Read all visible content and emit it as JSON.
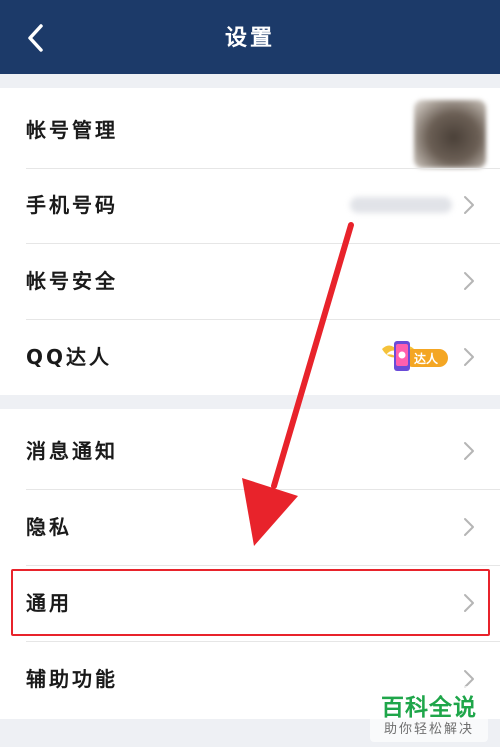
{
  "header": {
    "title": "设置",
    "back_icon": "chevron-left-icon"
  },
  "groups": [
    {
      "items": [
        {
          "label": "帐号管理",
          "accessory": "avatar"
        },
        {
          "label": "手机号码",
          "accessory": "blurred-phone-number"
        },
        {
          "label": "帐号安全",
          "accessory": "chevron"
        },
        {
          "label": "QQ达人",
          "accessory": "qq-daren-badge"
        }
      ]
    },
    {
      "items": [
        {
          "label": "消息通知",
          "accessory": "chevron"
        },
        {
          "label": "隐私",
          "accessory": "chevron"
        },
        {
          "label": "通用",
          "accessory": "chevron",
          "highlighted": true
        },
        {
          "label": "辅助功能",
          "accessory": "chevron"
        }
      ]
    }
  ],
  "badge": {
    "text": "达人"
  },
  "watermark": {
    "main": "百科全说",
    "sub": "助你轻松解决"
  },
  "colors": {
    "header_bg": "#1c3a69",
    "highlight": "#e8232b",
    "watermark_green": "#1fa64a",
    "page_bg": "#eef0f4"
  }
}
